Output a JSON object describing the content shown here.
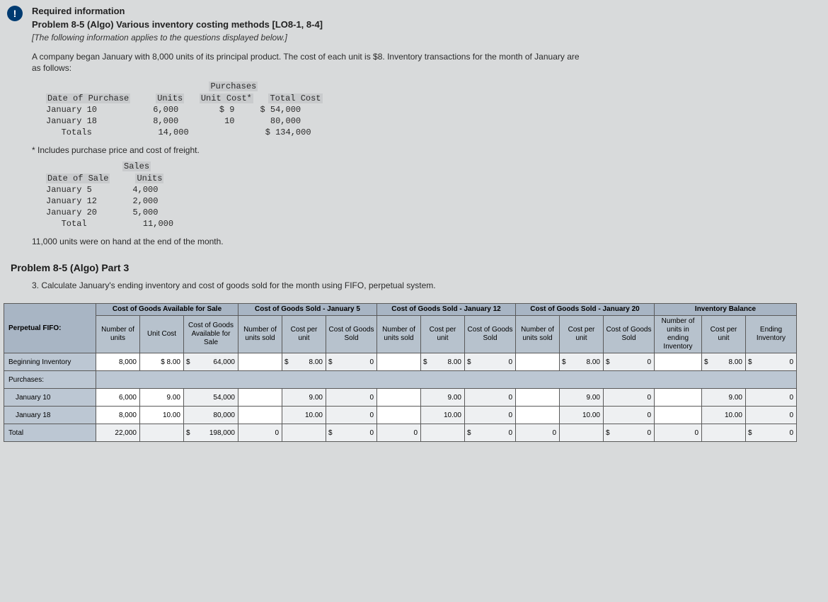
{
  "alert_icon": "!",
  "header": {
    "required_info": "Required information",
    "problem_title": "Problem 8-5 (Algo) Various inventory costing methods [LO8-1, 8-4]",
    "applies_note": "[The following information applies to the questions displayed below.]",
    "intro": "A company began January with 8,000 units of its principal product. The cost of each unit is $8. Inventory transactions for the month of January are as follows:"
  },
  "purchases_table": {
    "title": "Purchases",
    "h_date": "Date of Purchase",
    "h_units": "Units",
    "h_unitcost": "Unit Cost*",
    "h_totalcost": "Total Cost",
    "rows": [
      {
        "date": "January 10",
        "units": "6,000",
        "unitcost": "$ 9",
        "total": "$ 54,000"
      },
      {
        "date": "January 18",
        "units": "8,000",
        "unitcost": "10",
        "total": "80,000"
      }
    ],
    "totals_label": "Totals",
    "totals_units": "14,000",
    "totals_cost": "$ 134,000"
  },
  "freight_note": "* Includes purchase price and cost of freight.",
  "sales_table": {
    "title": "Sales",
    "h_date": "Date of Sale",
    "h_units": "Units",
    "rows": [
      {
        "date": "January 5",
        "units": "4,000"
      },
      {
        "date": "January 12",
        "units": "2,000"
      },
      {
        "date": "January 20",
        "units": "5,000"
      }
    ],
    "total_label": "Total",
    "total_units": "11,000"
  },
  "onhand_note": "11,000 units were on hand at the end of the month.",
  "part_heading": "Problem 8-5 (Algo) Part 3",
  "instruction": "3. Calculate January's ending inventory and cost of goods sold for the month using FIFO, perpetual system.",
  "answer_table": {
    "sections": {
      "avail": "Cost of Goods Available for Sale",
      "cogs5": "Cost of Goods Sold - January 5",
      "cogs12": "Cost of Goods Sold - January 12",
      "cogs20": "Cost of Goods Sold - January 20",
      "balance": "Inventory Balance"
    },
    "headers": {
      "perpetual": "Perpetual FIFO:",
      "num_units": "Number of units",
      "unit_cost": "Unit Cost",
      "cog_avail": "Cost of Goods Available for Sale",
      "num_sold": "Number of units sold",
      "cost_per_unit": "Cost per unit",
      "cogs": "Cost of Goods Sold",
      "num_end": "Number of units in ending Inventory",
      "end_cpu": "Cost per unit",
      "end_inv": "Ending Inventory"
    },
    "rows": {
      "beginning": {
        "label": "Beginning Inventory",
        "units": "8,000",
        "unitcost": "$ 8.00",
        "avail": "64,000",
        "j5_cpu": "8.00",
        "j5_cogs": "0",
        "j12_cpu": "8.00",
        "j12_cogs": "0",
        "j20_cpu": "8.00",
        "j20_cogs": "0",
        "bal_cpu": "8.00",
        "bal_inv": "0"
      },
      "purchases_label": "Purchases:",
      "jan10": {
        "label": "January 10",
        "units": "6,000",
        "unitcost": "9.00",
        "avail": "54,000",
        "j5_cpu": "9.00",
        "j5_cogs": "0",
        "j12_cpu": "9.00",
        "j12_cogs": "0",
        "j20_cpu": "9.00",
        "j20_cogs": "0",
        "bal_cpu": "9.00",
        "bal_inv": "0"
      },
      "jan18": {
        "label": "January 18",
        "units": "8,000",
        "unitcost": "10.00",
        "avail": "80,000",
        "j5_cpu": "10.00",
        "j5_cogs": "0",
        "j12_cpu": "10.00",
        "j12_cogs": "0",
        "j20_cpu": "10.00",
        "j20_cogs": "0",
        "bal_cpu": "10.00",
        "bal_inv": "0"
      },
      "total": {
        "label": "Total",
        "units": "22,000",
        "avail": "198,000",
        "j5_sold": "0",
        "j5_cogs": "0",
        "j12_sold": "0",
        "j12_cogs": "0",
        "j20_sold": "0",
        "j20_cogs": "0",
        "bal_units": "0",
        "bal_inv": "0"
      }
    }
  }
}
